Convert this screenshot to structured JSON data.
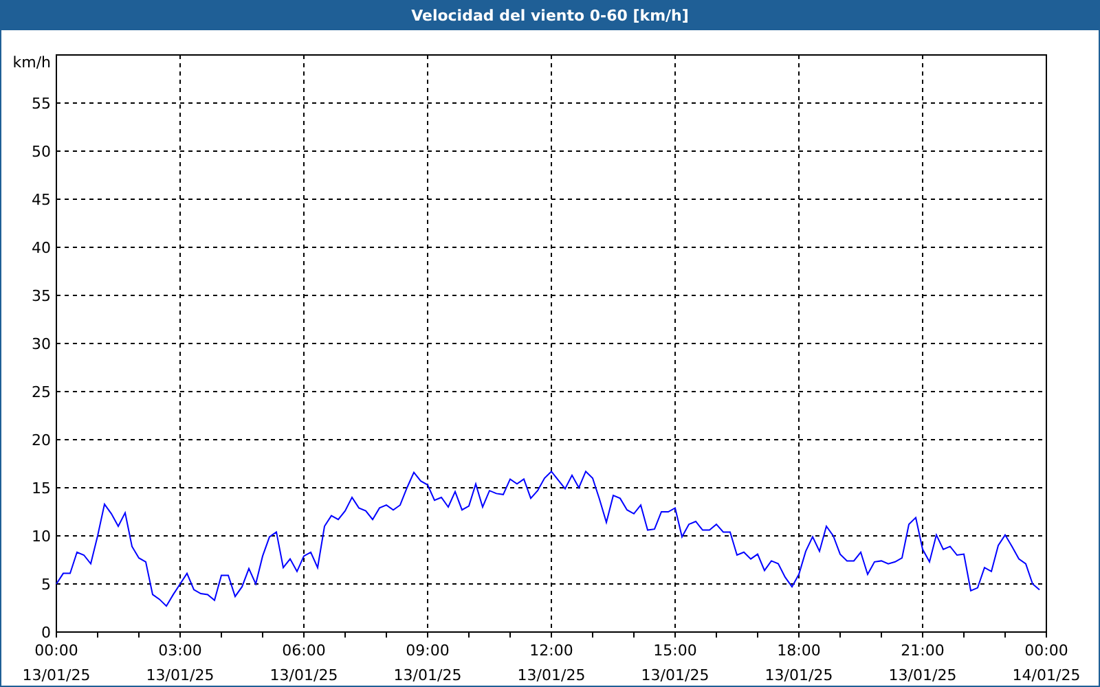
{
  "chart_data": {
    "type": "line",
    "title": "Velocidad del viento 0-60 [km/h]",
    "ylabel": "km/h",
    "ylim": [
      0,
      60
    ],
    "grid": true,
    "yticks": [
      0,
      5,
      10,
      15,
      20,
      25,
      30,
      35,
      40,
      45,
      50,
      55
    ],
    "categories": [
      "00:00\n13/01/25",
      null,
      null,
      null,
      null,
      null,
      null,
      null,
      null,
      null,
      null,
      null,
      null,
      null,
      null,
      null,
      null,
      null,
      "03:00\n13/01/25",
      null,
      null,
      null,
      null,
      null,
      null,
      null,
      null,
      null,
      null,
      null,
      null,
      null,
      null,
      null,
      null,
      null,
      "06:00\n13/01/25",
      null,
      null,
      null,
      null,
      null,
      null,
      null,
      null,
      null,
      null,
      null,
      null,
      null,
      null,
      null,
      null,
      null,
      "09:00\n13/01/25",
      null,
      null,
      null,
      null,
      null,
      null,
      null,
      null,
      null,
      null,
      null,
      null,
      null,
      null,
      null,
      null,
      null,
      "12:00\n13/01/25",
      null,
      null,
      null,
      null,
      null,
      null,
      null,
      null,
      null,
      null,
      null,
      null,
      null,
      null,
      null,
      null,
      null,
      "15:00\n13/01/25",
      null,
      null,
      null,
      null,
      null,
      null,
      null,
      null,
      null,
      null,
      null,
      null,
      null,
      null,
      null,
      null,
      null,
      "18:00\n13/01/25",
      null,
      null,
      null,
      null,
      null,
      null,
      null,
      null,
      null,
      null,
      null,
      null,
      null,
      null,
      null,
      null,
      null,
      "21:00\n13/01/25",
      null,
      null,
      null,
      null,
      null,
      null,
      null,
      null,
      null,
      null,
      null,
      null,
      null,
      null,
      null,
      null,
      null,
      "00:00\n14/01/25"
    ],
    "series": [
      {
        "color": "#0000ff",
        "values": [
          5.0,
          6.1,
          6.1,
          8.3,
          8.0,
          7.1,
          10,
          13.3,
          12.3,
          11,
          12.4,
          8.9,
          7.7,
          7.3,
          3.9,
          3.4,
          2.7,
          3.9,
          5.0,
          6.1,
          4.4,
          4.0,
          3.9,
          3.3,
          5.9,
          5.9,
          3.7,
          4.7,
          6.6,
          5.0,
          7.9,
          9.9,
          10.4,
          6.7,
          7.6,
          6.3,
          7.9,
          8.3,
          6.7,
          11,
          12.1,
          11.7,
          12.6,
          14,
          12.9,
          12.6,
          11.7,
          12.9,
          13.2,
          12.7,
          13.2,
          15,
          16.6,
          15.7,
          15.3,
          13.7,
          14,
          13,
          14.6,
          12.7,
          13.1,
          15.4,
          13,
          14.7,
          14.4,
          14.3,
          15.9,
          15.4,
          15.9,
          13.9,
          14.7,
          16,
          16.7,
          15.8,
          14.9,
          16.3,
          15,
          16.7,
          16,
          13.8,
          11.4,
          14.2,
          13.9,
          12.7,
          12.3,
          13.2,
          10.6,
          10.7,
          12.5,
          12.5,
          12.9,
          9.9,
          11.2,
          11.5,
          10.6,
          10.6,
          11.2,
          10.4,
          10.4,
          8,
          8.3,
          7.6,
          8.1,
          6.4,
          7.4,
          7.1,
          5.7,
          4.7,
          6,
          8.4,
          9.9,
          8.4,
          11,
          10,
          8.1,
          7.4,
          7.4,
          8.3,
          6,
          7.3,
          7.4,
          7.1,
          7.3,
          7.7,
          11.2,
          11.9,
          8.6,
          7.3,
          10.1,
          8.6,
          8.9,
          8,
          8.1,
          4.3,
          4.6,
          6.7,
          6.3,
          9,
          10.1,
          8.9,
          7.6,
          7.1,
          5,
          4.4,
          null
        ]
      }
    ]
  }
}
